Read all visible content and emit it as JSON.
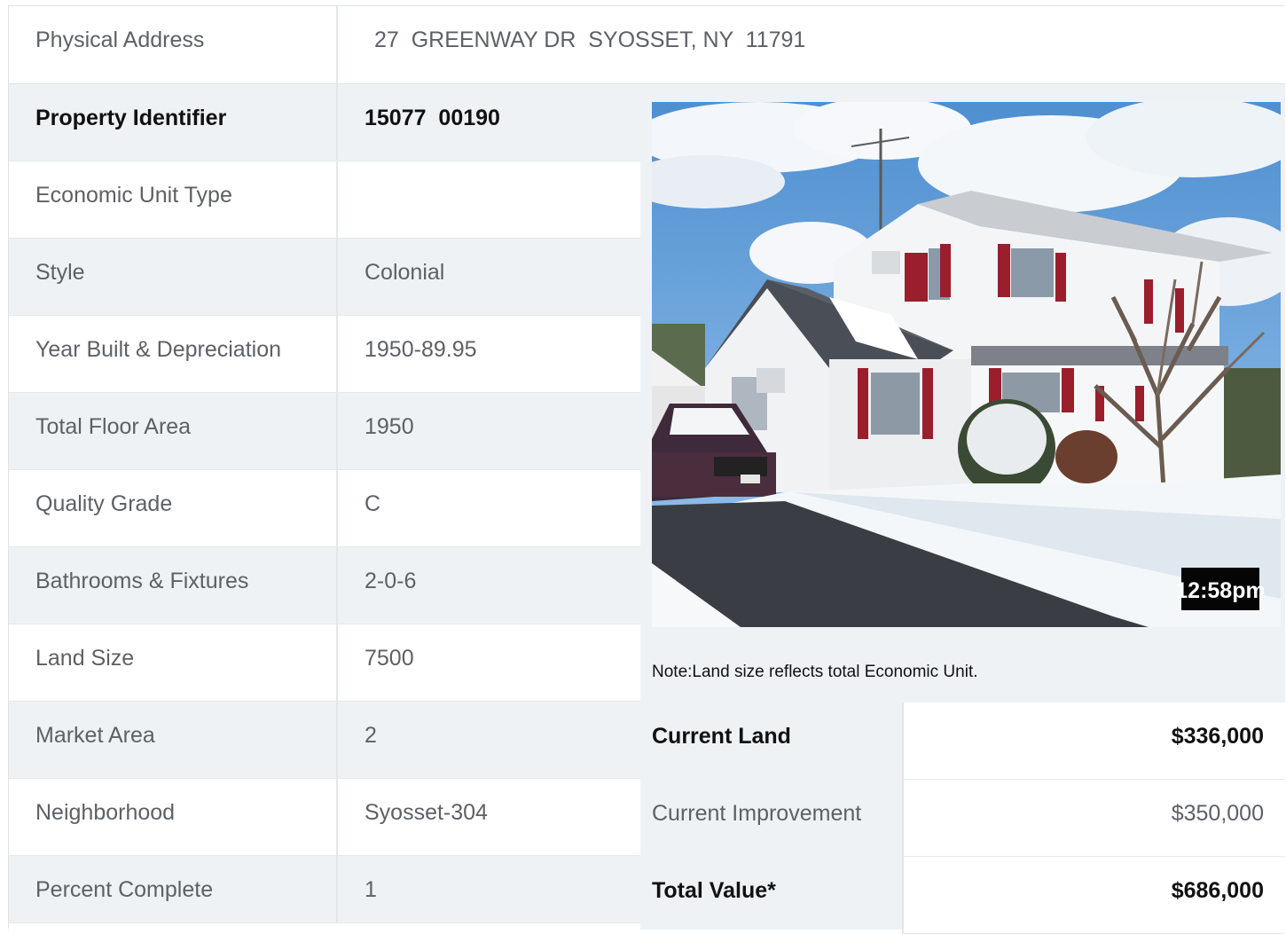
{
  "address": {
    "label": "Physical Address",
    "value": "27  GREENWAY DR  SYOSSET, NY  11791"
  },
  "property_rows": [
    {
      "label": "Property Identifier",
      "value": "15077  00190",
      "bold": true
    },
    {
      "label": "Economic Unit Type",
      "value": ""
    },
    {
      "label": "Style",
      "value": "Colonial"
    },
    {
      "label": "Year Built & Depreciation",
      "value": "1950-89.95"
    },
    {
      "label": "Total Floor Area",
      "value": "1950"
    },
    {
      "label": "Quality Grade",
      "value": "C"
    },
    {
      "label": "Bathrooms & Fixtures",
      "value": "2-0-6"
    },
    {
      "label": "Land Size",
      "value": "7500"
    },
    {
      "label": "Market Area",
      "value": "2"
    },
    {
      "label": "Neighborhood",
      "value": "Syosset-304"
    },
    {
      "label": "Percent Complete",
      "value": "1"
    }
  ],
  "photo": {
    "timestamp": "12:58pm"
  },
  "note": "Note:Land size reflects total Economic Unit.",
  "values": [
    {
      "label": "Current Land",
      "value": "$336,000",
      "bold": true
    },
    {
      "label": "Current Improvement",
      "value": "$350,000"
    },
    {
      "label": "Total Value*",
      "value": "$686,000",
      "bold": true
    }
  ],
  "colors": {
    "shade_row": "#eff2f5",
    "text_muted": "#5d6166",
    "text_strong": "#111111",
    "border": "#e3e7eb"
  }
}
